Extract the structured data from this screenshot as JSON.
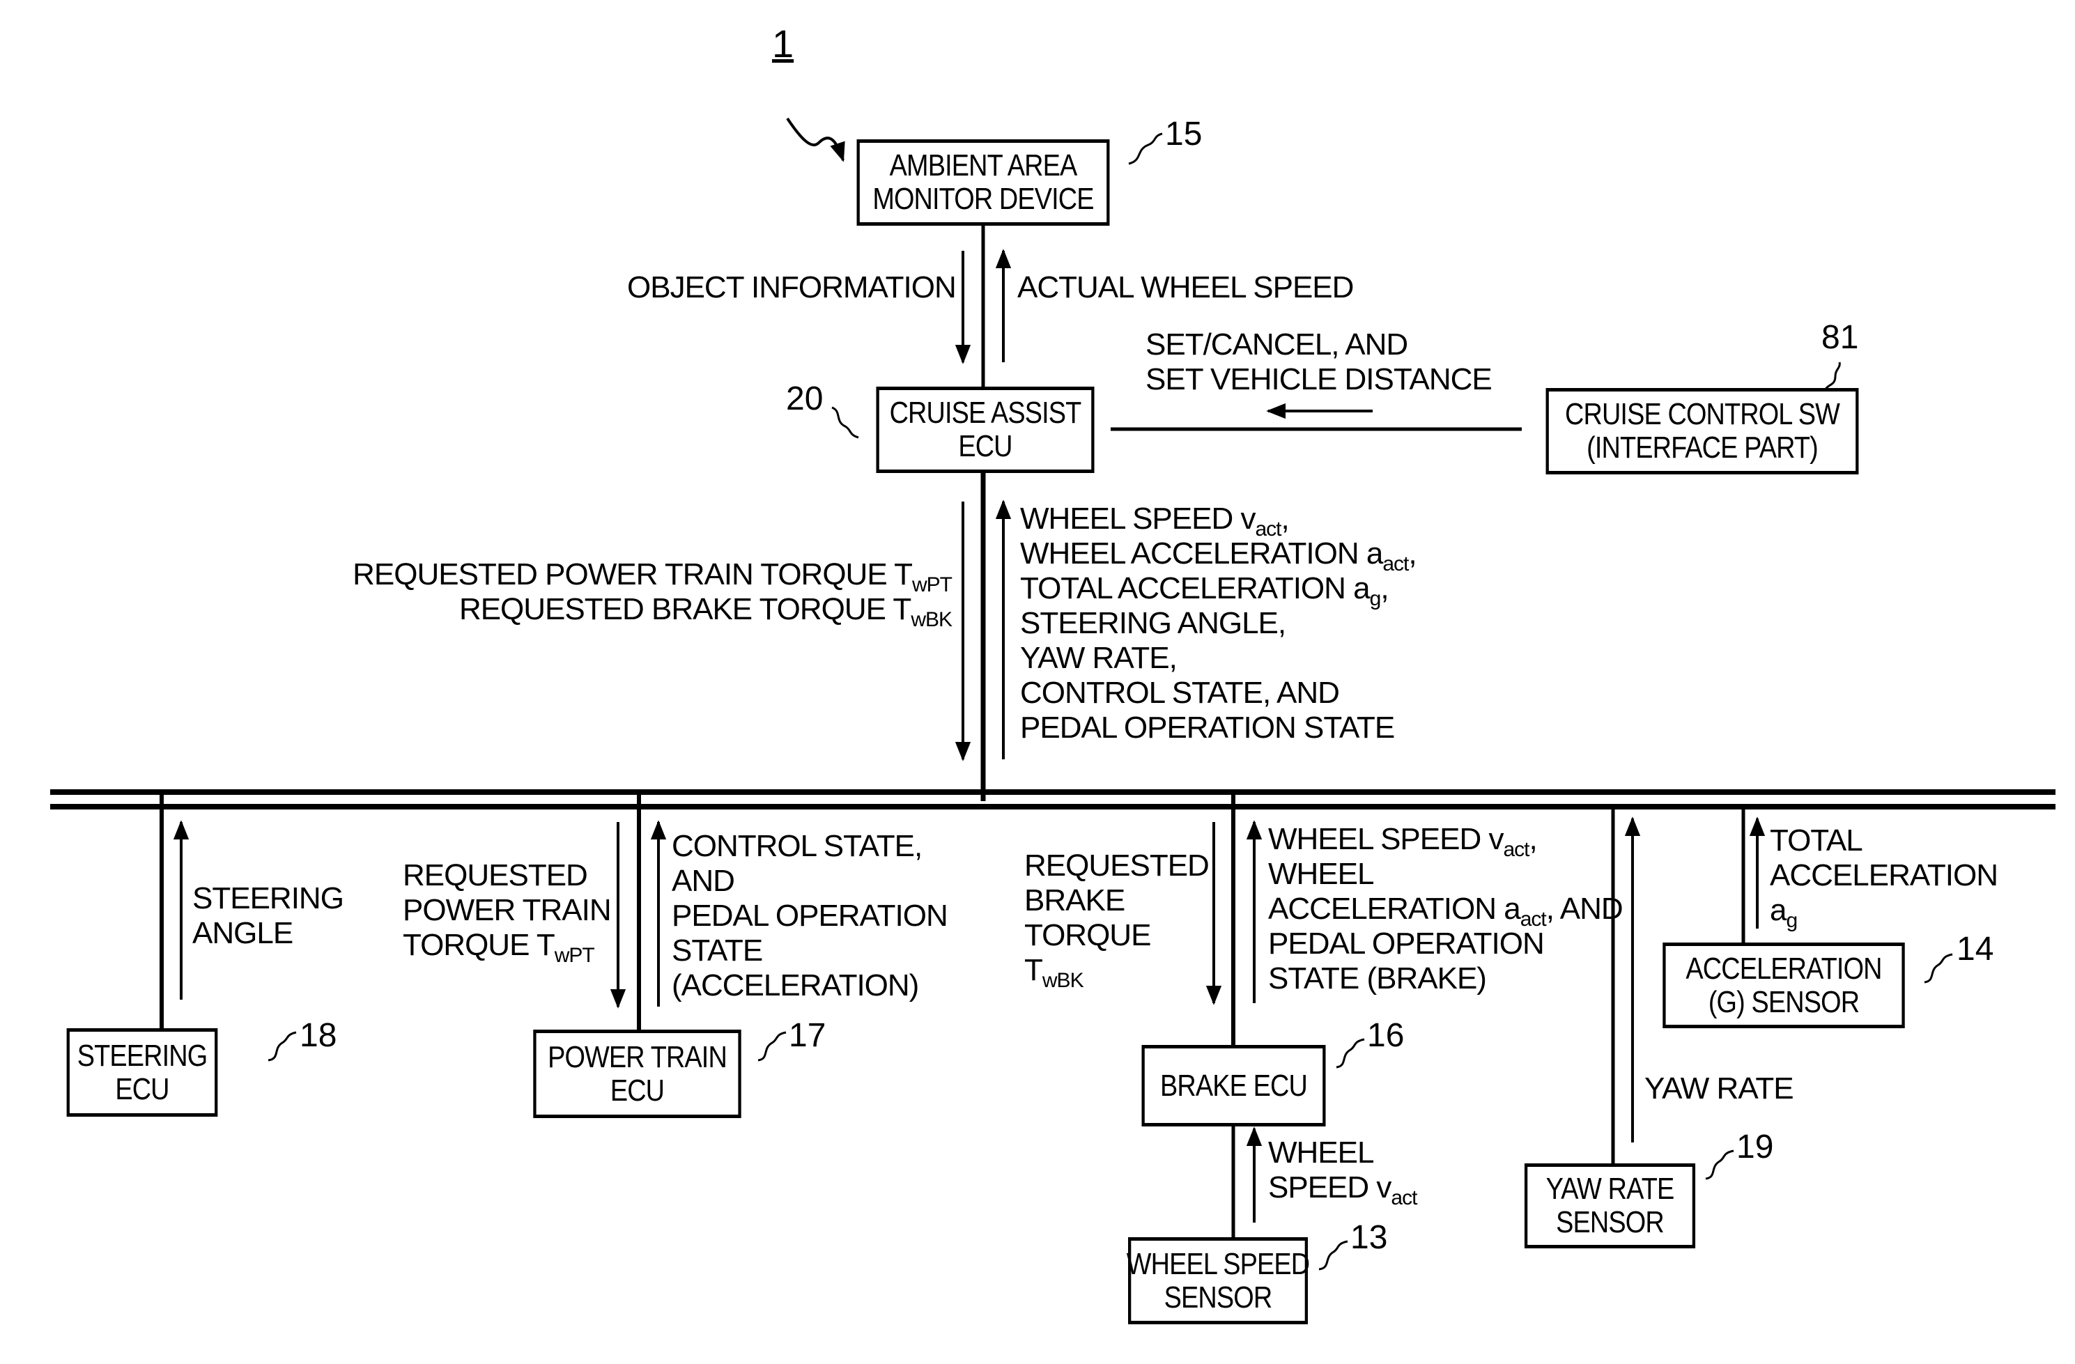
{
  "figure": {
    "reference": "1",
    "blocks": {
      "ambient_monitor": {
        "id": "15",
        "lines": [
          "AMBIENT AREA",
          "MONITOR DEVICE"
        ]
      },
      "cruise_assist": {
        "id": "20",
        "lines": [
          "CRUISE ASSIST",
          "ECU"
        ]
      },
      "cruise_sw": {
        "id": "81",
        "lines": [
          "CRUISE CONTROL SW",
          "(INTERFACE PART)"
        ]
      },
      "steering_ecu": {
        "id": "18",
        "lines": [
          "STEERING",
          "ECU"
        ]
      },
      "power_train_ecu": {
        "id": "17",
        "lines": [
          "POWER TRAIN",
          "ECU"
        ]
      },
      "brake_ecu": {
        "id": "16",
        "lines": [
          "BRAKE ECU"
        ]
      },
      "wheel_speed_sensor": {
        "id": "13",
        "lines": [
          "WHEEL SPEED",
          "SENSOR"
        ]
      },
      "yaw_rate_sensor": {
        "id": "19",
        "lines": [
          "YAW RATE",
          "SENSOR"
        ]
      },
      "accel_sensor": {
        "id": "14",
        "lines": [
          "ACCELERATION",
          "(G) SENSOR"
        ]
      }
    },
    "signals": {
      "object_information": "OBJECT INFORMATION",
      "actual_wheel_speed": "ACTUAL WHEEL SPEED",
      "set_cancel": [
        "SET/CANCEL, AND",
        "SET VEHICLE DISTANCE"
      ],
      "requested_to_bus": [
        {
          "text": "REQUESTED POWER TRAIN TORQUE T",
          "sub": "wPT"
        },
        {
          "text": "REQUESTED BRAKE TORQUE T",
          "sub": "wBK"
        }
      ],
      "bus_to_cruise": [
        {
          "text": "WHEEL SPEED v",
          "sub": "act",
          "tail": ","
        },
        {
          "text": "WHEEL ACCELERATION a",
          "sub": "act",
          "tail": ","
        },
        {
          "text": "TOTAL ACCELERATION a",
          "sub": "g",
          "tail": ","
        },
        {
          "text": "STEERING ANGLE,",
          "sub": "",
          "tail": ""
        },
        {
          "text": "YAW RATE,",
          "sub": "",
          "tail": ""
        },
        {
          "text": "CONTROL STATE, AND",
          "sub": "",
          "tail": ""
        },
        {
          "text": "PEDAL OPERATION STATE",
          "sub": "",
          "tail": ""
        }
      ],
      "steering_angle": [
        "STEERING",
        "ANGLE"
      ],
      "requested_pt": [
        {
          "text": "REQUESTED",
          "sub": ""
        },
        {
          "text": "POWER TRAIN",
          "sub": ""
        },
        {
          "text": "TORQUE T",
          "sub": "wPT"
        }
      ],
      "pt_state": [
        "CONTROL STATE,",
        "AND",
        "PEDAL OPERATION",
        "STATE",
        "(ACCELERATION)"
      ],
      "requested_bk": [
        {
          "text": "REQUESTED",
          "sub": ""
        },
        {
          "text": "BRAKE",
          "sub": ""
        },
        {
          "text": "TORQUE",
          "sub": ""
        },
        {
          "text": "T",
          "sub": "wBK"
        }
      ],
      "brake_state": [
        {
          "text": "WHEEL SPEED v",
          "sub": "act",
          "tail": ","
        },
        {
          "text": "WHEEL",
          "sub": "",
          "tail": ""
        },
        {
          "text": "ACCELERATION a",
          "sub": "act",
          "tail": ", AND"
        },
        {
          "text": "PEDAL OPERATION",
          "sub": "",
          "tail": ""
        },
        {
          "text": "STATE (BRAKE)",
          "sub": "",
          "tail": ""
        }
      ],
      "wheel_speed_sensor_out": [
        {
          "text": "WHEEL",
          "sub": ""
        },
        {
          "text": "SPEED v",
          "sub": "act"
        }
      ],
      "yaw_rate": "YAW RATE",
      "total_accel": [
        {
          "text": "TOTAL",
          "sub": ""
        },
        {
          "text": "ACCELERATION",
          "sub": ""
        },
        {
          "text": "a",
          "sub": "g"
        }
      ]
    }
  }
}
